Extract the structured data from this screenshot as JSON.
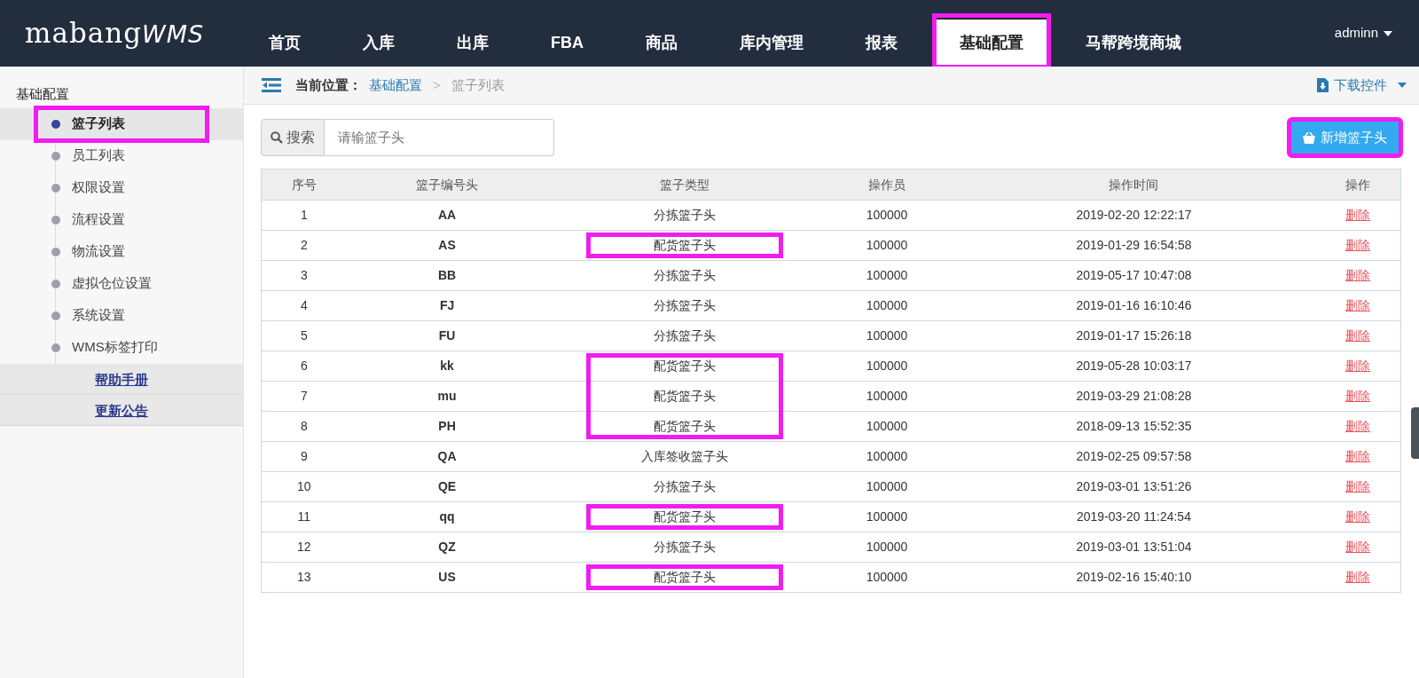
{
  "logo": {
    "text": "mabang",
    "accent": "WMS"
  },
  "nav": [
    {
      "label": "首页",
      "selected": false,
      "highlighted": false
    },
    {
      "label": "入库",
      "selected": false,
      "highlighted": false
    },
    {
      "label": "出库",
      "selected": false,
      "highlighted": false
    },
    {
      "label": "FBA",
      "selected": false,
      "highlighted": false
    },
    {
      "label": "商品",
      "selected": false,
      "highlighted": false
    },
    {
      "label": "库内管理",
      "selected": false,
      "highlighted": false
    },
    {
      "label": "报表",
      "selected": false,
      "highlighted": false
    },
    {
      "label": "基础配置",
      "selected": true,
      "highlighted": true
    },
    {
      "label": "马帮跨境商城",
      "selected": false,
      "highlighted": false
    }
  ],
  "user": "adminn",
  "sidebar": {
    "title": "基础配置",
    "items": [
      {
        "label": "篮子列表",
        "selected": true,
        "highlighted": true
      },
      {
        "label": "员工列表",
        "selected": false,
        "highlighted": false
      },
      {
        "label": "权限设置",
        "selected": false,
        "highlighted": false
      },
      {
        "label": "流程设置",
        "selected": false,
        "highlighted": false
      },
      {
        "label": "物流设置",
        "selected": false,
        "highlighted": false
      },
      {
        "label": "虚拟仓位设置",
        "selected": false,
        "highlighted": false
      },
      {
        "label": "系统设置",
        "selected": false,
        "highlighted": false
      },
      {
        "label": "WMS标签打印",
        "selected": false,
        "highlighted": false
      }
    ],
    "links": [
      "帮助手册",
      "更新公告"
    ]
  },
  "breadcrumb": {
    "label": "当前位置：",
    "items": [
      "基础配置",
      "篮子列表"
    ],
    "separator": ">"
  },
  "download": "下载控件",
  "search": {
    "button": "搜索",
    "placeholder": "请输篮子头"
  },
  "add_button": {
    "label": "新增篮子头",
    "highlighted": true
  },
  "table": {
    "columns": [
      "序号",
      "篮子编号头",
      "篮子类型",
      "操作员",
      "操作时间",
      "操作"
    ],
    "rows": [
      {
        "no": "1",
        "code": "AA",
        "type": "分拣篮子头",
        "operator": "100000",
        "time": "2019-02-20 12:22:17",
        "action": "删除",
        "highlighted": false
      },
      {
        "no": "2",
        "code": "AS",
        "type": "配货篮子头",
        "operator": "100000",
        "time": "2019-01-29 16:54:58",
        "action": "删除",
        "highlighted": true
      },
      {
        "no": "3",
        "code": "BB",
        "type": "分拣篮子头",
        "operator": "100000",
        "time": "2019-05-17 10:47:08",
        "action": "删除",
        "highlighted": false
      },
      {
        "no": "4",
        "code": "FJ",
        "type": "分拣篮子头",
        "operator": "100000",
        "time": "2019-01-16 16:10:46",
        "action": "删除",
        "highlighted": false
      },
      {
        "no": "5",
        "code": "FU",
        "type": "分拣篮子头",
        "operator": "100000",
        "time": "2019-01-17 15:26:18",
        "action": "删除",
        "highlighted": false
      },
      {
        "no": "6",
        "code": "kk",
        "type": "配货篮子头",
        "operator": "100000",
        "time": "2019-05-28 10:03:17",
        "action": "删除",
        "highlighted": true
      },
      {
        "no": "7",
        "code": "mu",
        "type": "配货篮子头",
        "operator": "100000",
        "time": "2019-03-29 21:08:28",
        "action": "删除",
        "highlighted": true
      },
      {
        "no": "8",
        "code": "PH",
        "type": "配货篮子头",
        "operator": "100000",
        "time": "2018-09-13 15:52:35",
        "action": "删除",
        "highlighted": true
      },
      {
        "no": "9",
        "code": "QA",
        "type": "入库签收篮子头",
        "operator": "100000",
        "time": "2019-02-25 09:57:58",
        "action": "删除",
        "highlighted": false
      },
      {
        "no": "10",
        "code": "QE",
        "type": "分拣篮子头",
        "operator": "100000",
        "time": "2019-03-01 13:51:26",
        "action": "删除",
        "highlighted": false
      },
      {
        "no": "11",
        "code": "qq",
        "type": "配货篮子头",
        "operator": "100000",
        "time": "2019-03-20 11:24:54",
        "action": "删除",
        "highlighted": true
      },
      {
        "no": "12",
        "code": "QZ",
        "type": "分拣篮子头",
        "operator": "100000",
        "time": "2019-03-01 13:51:04",
        "action": "删除",
        "highlighted": false
      },
      {
        "no": "13",
        "code": "US",
        "type": "配货篮子头",
        "operator": "100000",
        "time": "2019-02-16 15:40:10",
        "action": "删除",
        "highlighted": true
      }
    ]
  }
}
